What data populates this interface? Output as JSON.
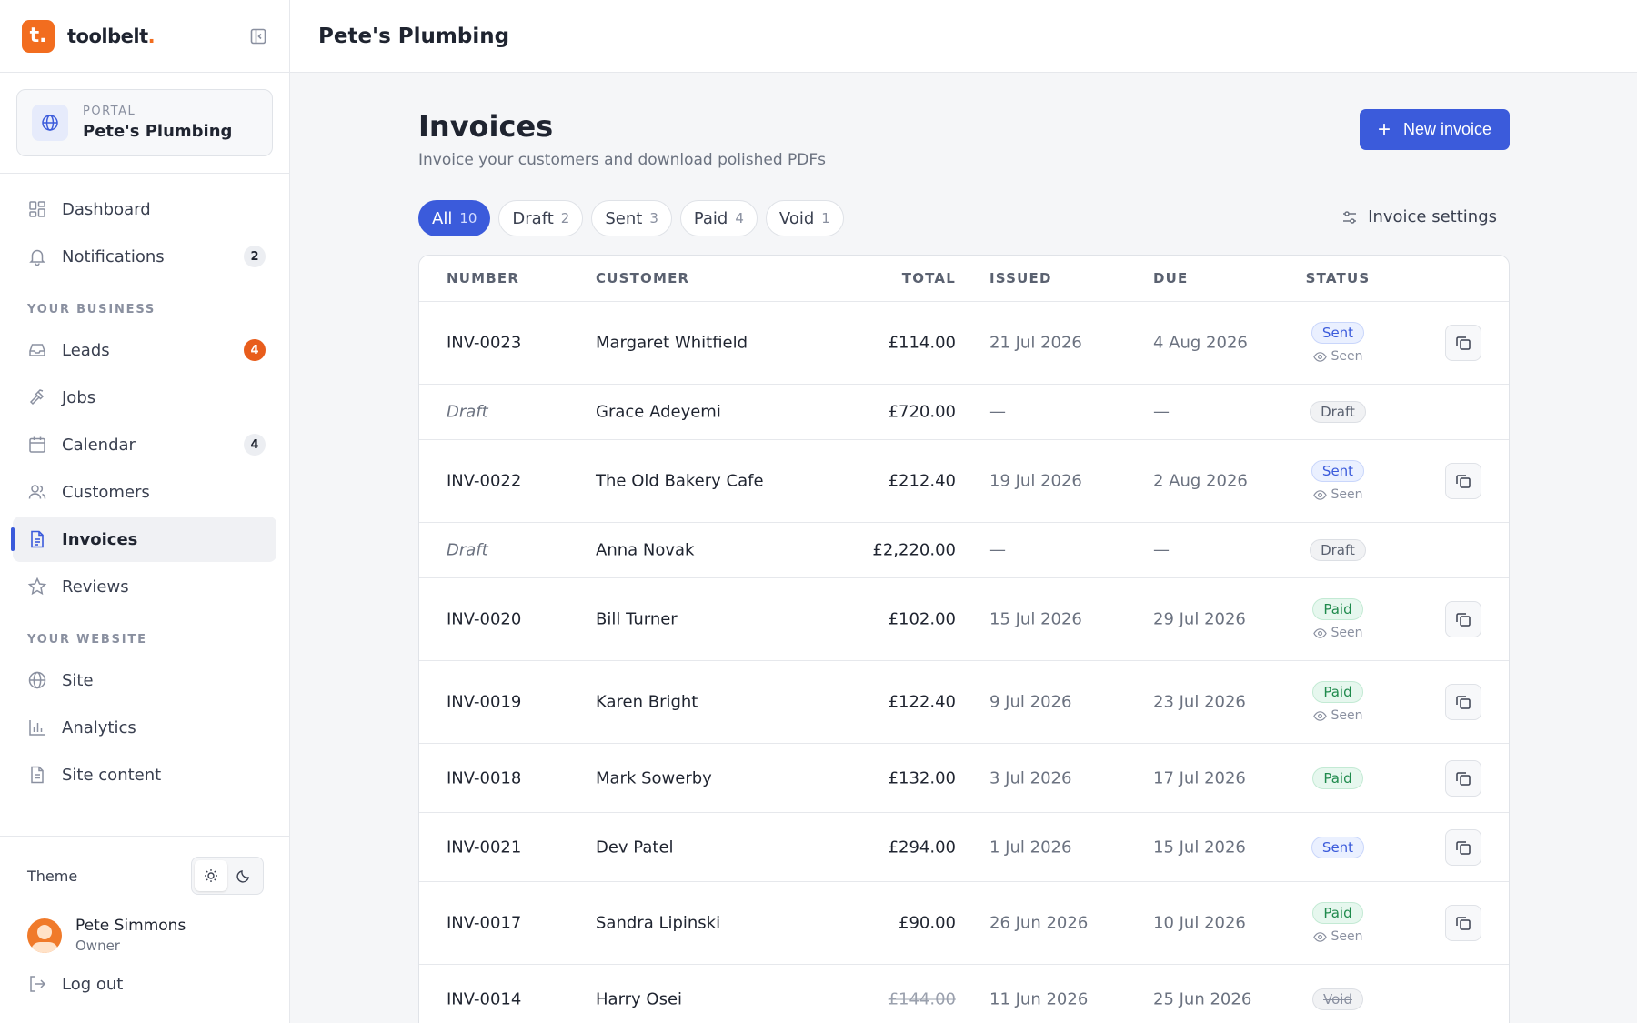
{
  "brand": {
    "logo_letter": "t.",
    "name": "toolbelt",
    "name_dot": "."
  },
  "portal": {
    "label": "PORTAL",
    "name": "Pete's Plumbing"
  },
  "nav": {
    "main": [
      {
        "label": "Dashboard",
        "icon": "grid-icon"
      },
      {
        "label": "Notifications",
        "icon": "bell-icon",
        "badge": "2"
      }
    ],
    "business_label": "YOUR BUSINESS",
    "business": [
      {
        "label": "Leads",
        "icon": "inbox-icon",
        "badge": "4"
      },
      {
        "label": "Jobs",
        "icon": "hammer-icon"
      },
      {
        "label": "Calendar",
        "icon": "calendar-icon",
        "badge": "4"
      },
      {
        "label": "Customers",
        "icon": "users-icon"
      },
      {
        "label": "Invoices",
        "icon": "file-text-icon"
      },
      {
        "label": "Reviews",
        "icon": "star-icon"
      }
    ],
    "website_label": "YOUR WEBSITE",
    "website": [
      {
        "label": "Site",
        "icon": "globe-icon"
      },
      {
        "label": "Analytics",
        "icon": "bar-chart-icon"
      },
      {
        "label": "Site content",
        "icon": "document-icon"
      }
    ]
  },
  "footer": {
    "theme_label": "Theme",
    "user_name": "Pete Simmons",
    "user_role": "Owner",
    "logout_label": "Log out"
  },
  "topbar": {
    "title": "Pete's Plumbing"
  },
  "page": {
    "title": "Invoices",
    "subtitle": "Invoice your customers and download polished PDFs",
    "new_button": "New invoice",
    "settings_link": "Invoice settings"
  },
  "filters": [
    {
      "label": "All",
      "count": "10"
    },
    {
      "label": "Draft",
      "count": "2"
    },
    {
      "label": "Sent",
      "count": "3"
    },
    {
      "label": "Paid",
      "count": "4"
    },
    {
      "label": "Void",
      "count": "1"
    }
  ],
  "table": {
    "headers": {
      "number": "NUMBER",
      "customer": "CUSTOMER",
      "total": "TOTAL",
      "issued": "ISSUED",
      "due": "DUE",
      "status": "STATUS"
    },
    "rows": [
      {
        "number": "INV-0023",
        "customer": "Margaret Whitfield",
        "total": "£114.00",
        "issued": "21 Jul 2026",
        "due": "4 Aug 2026",
        "status": "Sent",
        "seen": "Seen"
      },
      {
        "number": "Draft",
        "customer": "Grace Adeyemi",
        "total": "£720.00",
        "issued": "—",
        "due": "—",
        "status": "Draft"
      },
      {
        "number": "INV-0022",
        "customer": "The Old Bakery Cafe",
        "total": "£212.40",
        "issued": "19 Jul 2026",
        "due": "2 Aug 2026",
        "status": "Sent",
        "seen": "Seen"
      },
      {
        "number": "Draft",
        "customer": "Anna Novak",
        "total": "£2,220.00",
        "issued": "—",
        "due": "—",
        "status": "Draft"
      },
      {
        "number": "INV-0020",
        "customer": "Bill Turner",
        "total": "£102.00",
        "issued": "15 Jul 2026",
        "due": "29 Jul 2026",
        "status": "Paid",
        "seen": "Seen"
      },
      {
        "number": "INV-0019",
        "customer": "Karen Bright",
        "total": "£122.40",
        "issued": "9 Jul 2026",
        "due": "23 Jul 2026",
        "status": "Paid",
        "seen": "Seen"
      },
      {
        "number": "INV-0018",
        "customer": "Mark Sowerby",
        "total": "£132.00",
        "issued": "3 Jul 2026",
        "due": "17 Jul 2026",
        "status": "Paid"
      },
      {
        "number": "INV-0021",
        "customer": "Dev Patel",
        "total": "£294.00",
        "issued": "1 Jul 2026",
        "due": "15 Jul 2026",
        "status": "Sent"
      },
      {
        "number": "INV-0017",
        "customer": "Sandra Lipinski",
        "total": "£90.00",
        "issued": "26 Jun 2026",
        "due": "10 Jul 2026",
        "status": "Paid",
        "seen": "Seen"
      },
      {
        "number": "INV-0014",
        "customer": "Harry Osei",
        "total": "£144.00",
        "issued": "11 Jun 2026",
        "due": "25 Jun 2026",
        "status": "Void"
      }
    ]
  },
  "colors": {
    "accent": "#3b5bdb",
    "brand": "#f26d1f",
    "badge_orange": "#e85d1c",
    "paid": "#1f8a4c"
  }
}
